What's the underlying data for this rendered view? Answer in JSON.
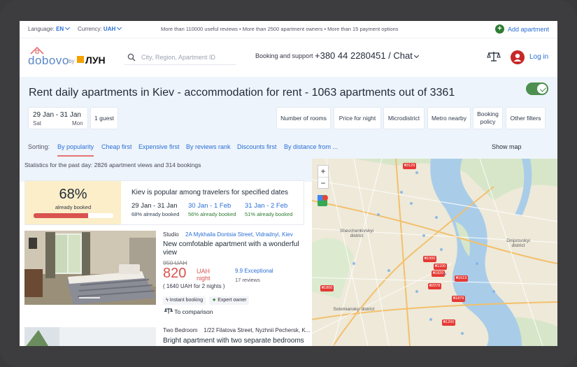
{
  "topbar": {
    "language_label": "Language:",
    "language_value": "EN",
    "currency_label": "Currency:",
    "currency_value": "UAH",
    "promo": "More than 110000 useful reviews • More than 2500 apartment owners • More than 15 payment options",
    "add_apartment": "Add apartment"
  },
  "header": {
    "logo_text": "dobovo",
    "logo_by": "by",
    "logo_lun": "ЛУН",
    "search_placeholder": "City, Region, Apartment ID",
    "support_label": "Booking and support",
    "phone": "+380 44 2280451 / Chat",
    "login": "Log in"
  },
  "main": {
    "title": "Rent daily apartments in Kiev - accommodation for rent - 1063 apartments out of 3361",
    "dates": {
      "range": "29 Jan - 31 Jan",
      "start_day": "Sat",
      "end_day": "Mon"
    },
    "guests": "1 guest",
    "filters": [
      "Number of rooms",
      "Price for night",
      "Microdistrict",
      "Metro nearby",
      "Booking policy",
      "Other filters"
    ],
    "sorting_label": "Sorting:",
    "sort_options": [
      "By popularity",
      "Cheap first",
      "Expensive first",
      "By reviews rank",
      "Discounts first",
      "By distance from ..."
    ],
    "show_map": "Show map",
    "show_map_on": true,
    "stats": "Statistics for the past day: 2826 apartment views and 314 bookings"
  },
  "popular": {
    "percent_text": "68%",
    "percent_value": 68,
    "booked_label": "already booked",
    "headline": "Kiev is popular among travelers for specified dates",
    "dates": [
      {
        "range": "29 Jan - 31 Jan",
        "note": "68% already booked",
        "color": "#1f2a37",
        "note_color": "#334455"
      },
      {
        "range": "30 Jan - 1 Feb",
        "note": "56% already booked",
        "color": "#2a6fd6",
        "note_color": "#2e7d32"
      },
      {
        "range": "31 Jan - 2 Feb",
        "note": "51% already booked",
        "color": "#2a6fd6",
        "note_color": "#2e7d32"
      }
    ]
  },
  "listing1": {
    "type": "Studio",
    "address": "2A Mykhaila Dontsia Street, Vidradnyi, Kiev",
    "title": "New comfotable apartment with a wonderful view",
    "old_price": "950 UAH",
    "price": "820",
    "currency": "UAH",
    "per": "night",
    "note": "( 1640 UAH for 2 nights )",
    "rating": "9.9 Exceptional",
    "reviews": "17 reviews",
    "tag_instant": "Instant booking",
    "tag_expert": "Expert owner",
    "compare": "To comparison"
  },
  "listing2": {
    "type": "Two Bedroom",
    "address": "1/22 Filatova Street, Nyzhnii Pechersk, K...",
    "title": "Bright apartment with two separate bedrooms"
  },
  "map": {
    "zoom_in": "+",
    "zoom_out": "−",
    "districts": [
      "Shevchenkivskyi district",
      "Dniprovskyi district",
      "Solomianskyi district"
    ],
    "markers": [
      "₴3129",
      "₴1000",
      "₴1100",
      "₴1820",
      "₴1619",
      "₴2078",
      "₴1879",
      "₴1800",
      "₴1200"
    ]
  }
}
